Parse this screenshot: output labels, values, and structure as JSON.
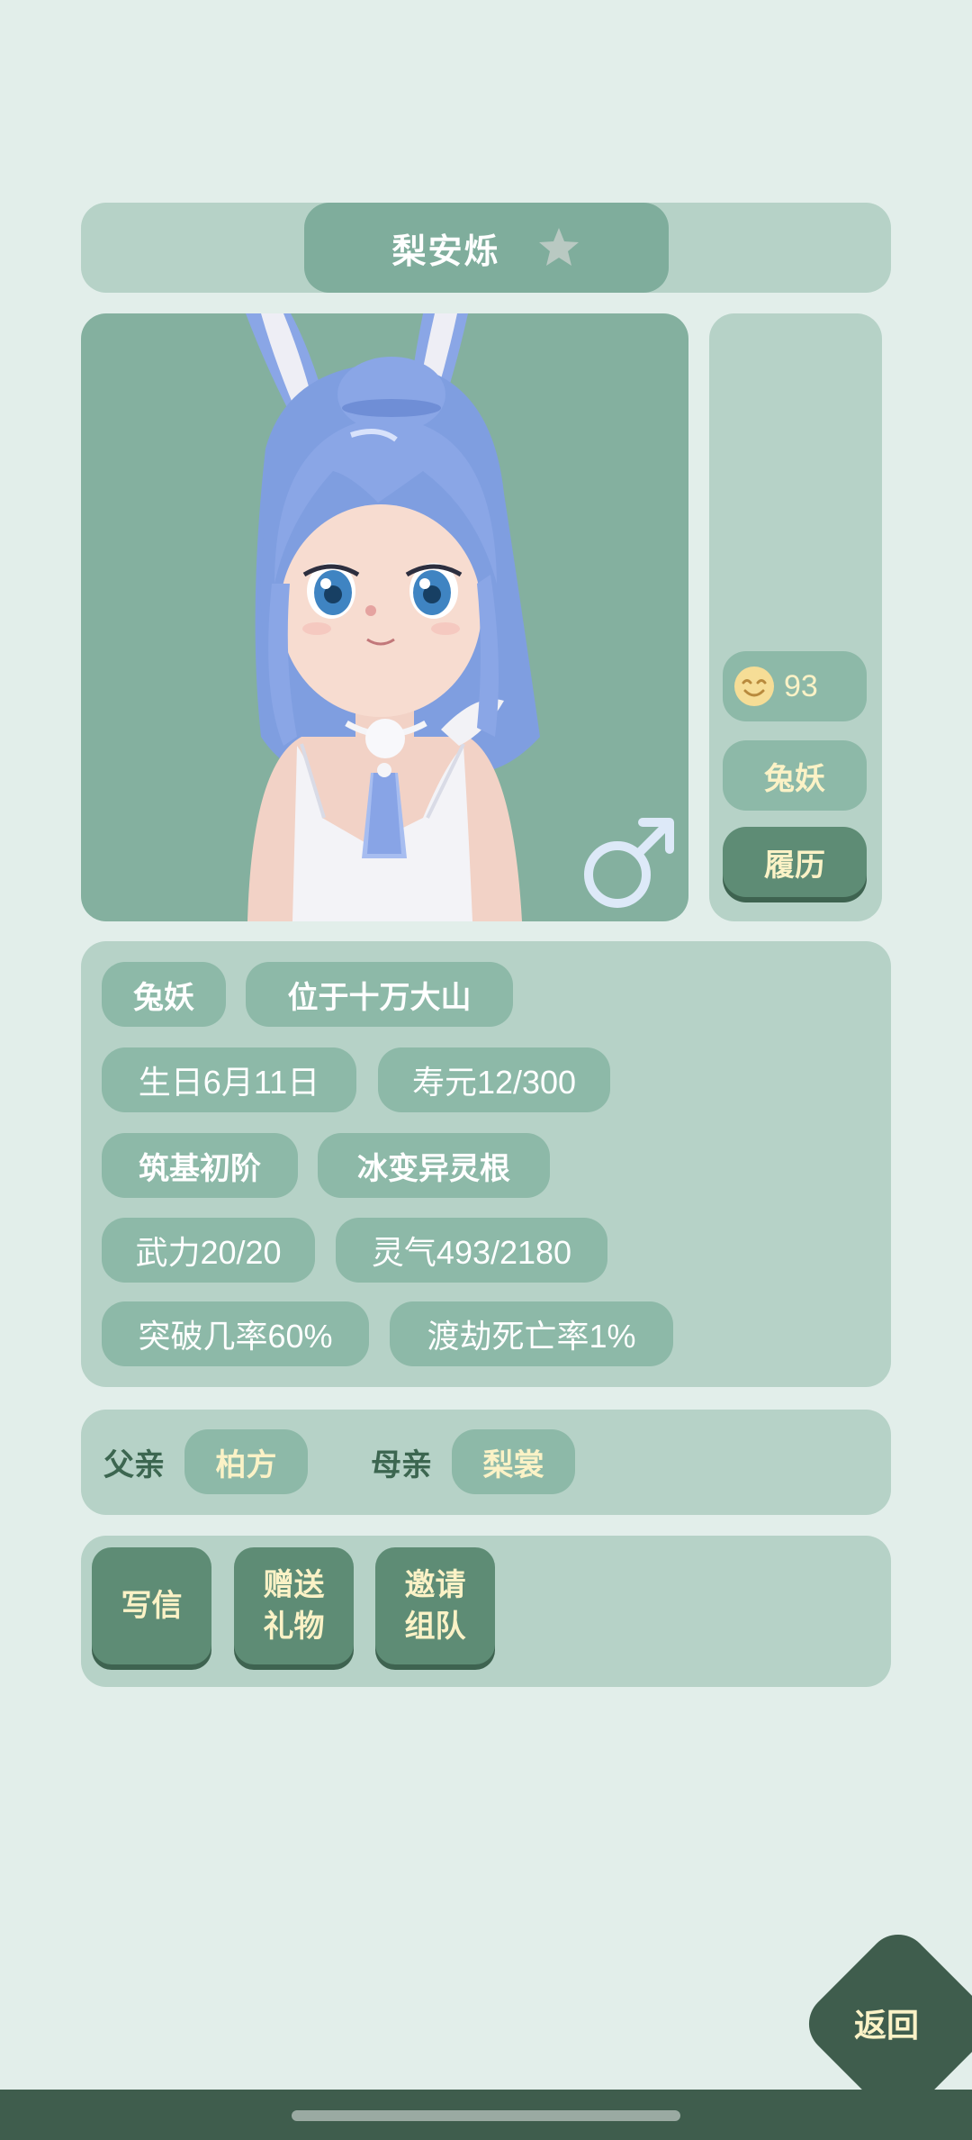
{
  "header": {
    "name": "梨安烁",
    "favorite_icon": "star-icon"
  },
  "portrait": {
    "character_art": "rabbit-girl-portrait",
    "gender_icon": "male-symbol-icon"
  },
  "side_panel": {
    "mood_icon": "smiling-face-icon",
    "mood_value": "93",
    "race": "兔妖",
    "history_button": "履历"
  },
  "stats": [
    [
      "兔妖",
      "位于十万大山"
    ],
    [
      "生日6月11日",
      "寿元12/300"
    ],
    [
      "筑基初阶",
      "冰变异灵根"
    ],
    [
      "武力20/20",
      "灵气493/2180"
    ],
    [
      "突破几率60%",
      "渡劫死亡率1%"
    ]
  ],
  "parents": {
    "father_label": "父亲",
    "father_name": "柏方",
    "mother_label": "母亲",
    "mother_name": "梨裳"
  },
  "actions": {
    "write_letter": "写信",
    "send_gift": "赠送\n礼物",
    "invite_team": "邀请\n组队"
  },
  "return_button": "返回",
  "colors": {
    "background": "#e2eeea",
    "panel": "#b6d2c7",
    "chip": "#8db9a8",
    "button": "#5e8c75",
    "dark": "#3f5d4d",
    "accent_text": "#fbf2c6",
    "hair": "#8aa6e6"
  }
}
